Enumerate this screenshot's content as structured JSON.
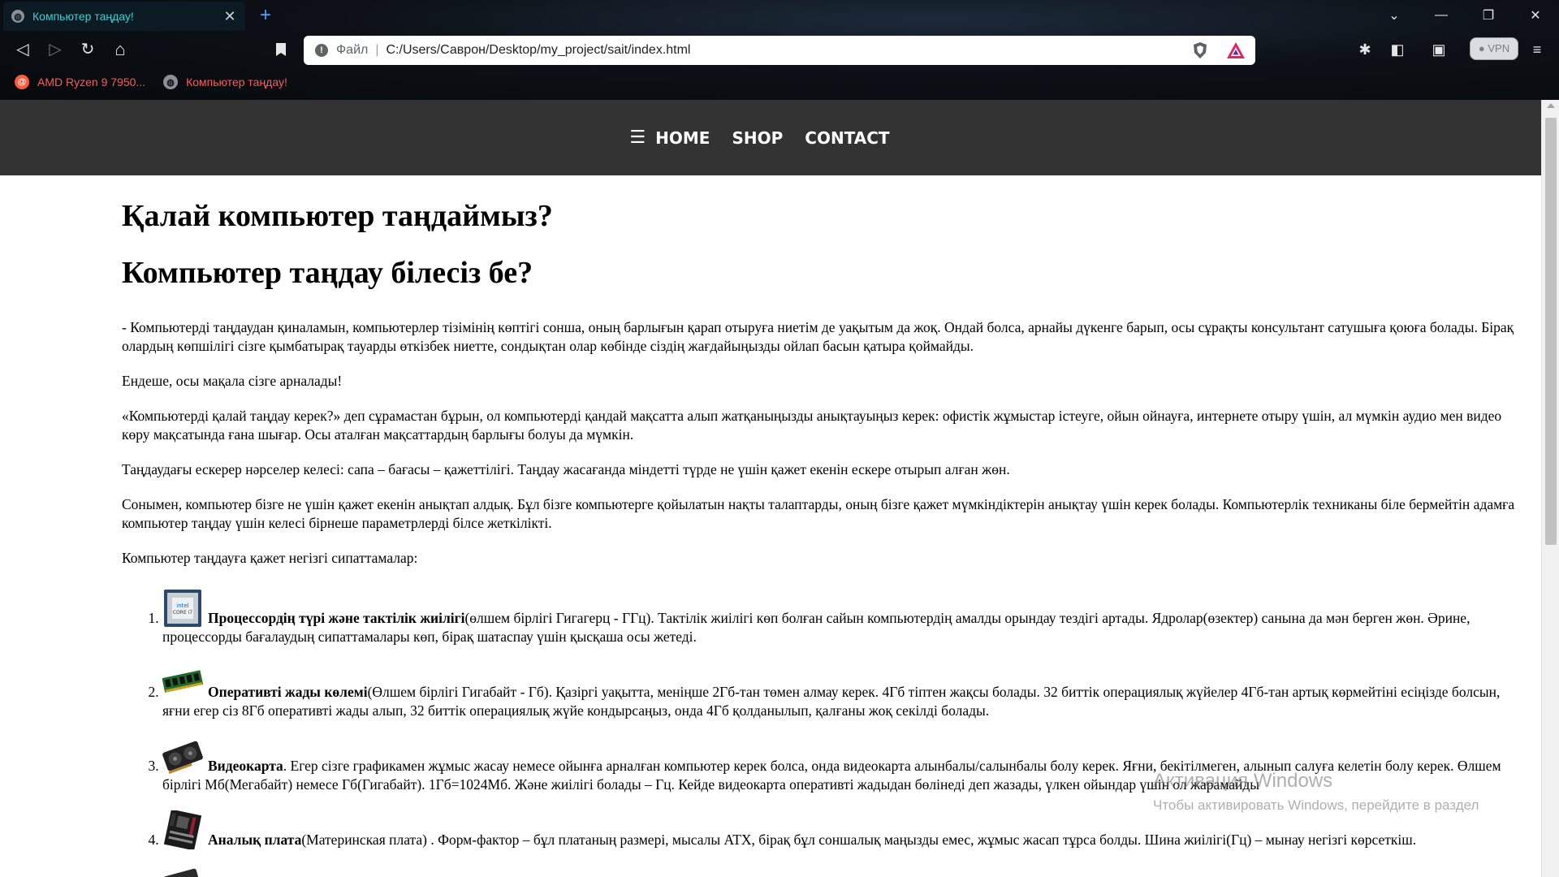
{
  "browser": {
    "tab": {
      "title": "Компьютер таңдау!",
      "close_glyph": "✕"
    },
    "new_tab_glyph": "+",
    "window_controls": {
      "dropdown": "⌄",
      "minimize": "—",
      "restore": "❐",
      "close": "✕"
    },
    "nav": {
      "back": "◁",
      "forward": "▷",
      "reload": "↻",
      "home": "⌂"
    },
    "address": {
      "scheme": "Файл",
      "url": "C:/Users/Саврон/Desktop/my_project/sait/index.html"
    },
    "toolbar_right": {
      "extensions": "✱",
      "sidebar": "◧",
      "wallet": "▣",
      "vpn": "VPN",
      "menu": "≡"
    },
    "bookmarks": [
      {
        "label": "AMD Ryzen 9 7950...",
        "icon": "amd-icon",
        "color": "#ff5a3c"
      },
      {
        "label": "Компьютер таңдау!",
        "icon": "globe-icon",
        "color": "#8a8f98"
      }
    ]
  },
  "site": {
    "nav": {
      "menu_icon": "☰",
      "items": [
        "HOME",
        "SHOP",
        "CONTACT"
      ]
    },
    "heading1": "Қалай компьютер таңдаймыз?",
    "heading2": "Компьютер таңдау білесіз бе?",
    "paragraphs": [
      "- Компьютерді таңдаудан қиналамын, компьютерлер тізімінің көптігі сонша, оның барлығын қарап отыруға ниетім де уақытым да жоқ. Ондай болса, арнайы дүкенге барып, осы сұрақты консультант сатушыға қоюға болады. Бірақ олардың көпшілігі сізге қымбатырақ тауарды өткізбек ниетте, сондықтан олар көбінде сіздің жағдайыңызды ойлап басын қатыра қоймайды.",
      "Ендеше, осы мақала сізге арналады!",
      "«Компьютерді қалай таңдау керек?» деп сұрамастан бұрын, ол компьютерді қандай мақсатта алып жатқаныңызды анықтауыңыз керек: офистік жұмыстар істеуге, ойын ойнауға, интернете отыру үшін, ал мүмкін аудио мен видео көру мақсатында ғана шығар. Осы аталған мақсаттардың барлығы болуы да мүмкін.",
      "Таңдаудағы ескерер нәрселер келесі: сапа – бағасы – қажеттілігі. Таңдау жасағанда міндетті түрде не үшін қажет екенін ескере отырып алған жөн.",
      "Сонымен, компьютер бізге не үшін қажет екенін анықтап алдық. Бұл бізге компьютерге қойылатын нақты талаптарды, оның бізге қажет мүмкіндіктерін анықтау үшін керек болады. Компьютерлік техниканы біле бермейтін адамға компьютер таңдау үшін келесі бірнеше параметрлерді білсе жеткілікті.",
      "Компьютер таңдауға қажет негізгі сипаттамалар:"
    ],
    "list": [
      {
        "icon": "cpu-icon",
        "bold": "Процессордің түрі және тактілік жиілігі",
        "text": "(өлшем бірлігі Гигагерц - ГГц). Тактілік жиілігі көп болған сайын компьютердің амалды орындау тездігі артады. Ядролар(өзектер) санына да мән берген жөн. Әрине, процессорды бағалаудың сипаттамалары көп, бірақ шатаспау үшін қысқаша осы жетеді."
      },
      {
        "icon": "ram-icon",
        "bold": "Оперативті жады көлемі",
        "text": "(Өлшем бірлігі Гигабайт - Гб). Қазіргі уақытта, меніңше 2Гб-тан төмен алмау керек. 4Гб тіптен жақсы болады. 32 биттік операциялық жүйелер 4Гб-тан артық көрмейтіні есіңізде болсын, яғни егер сіз 8Гб оперативті жады алып, 32 биттік операциялық жүйе кондырсаңыз, онда 4Гб қолданылып, қалғаны жоқ секілді болады."
      },
      {
        "icon": "gpu-icon",
        "bold": "Видеокарта",
        "text": ". Егер сізге графикамен жұмыс жасау немесе ойынға арналған компьютер керек болса, онда видеокарта алынбалы/салынбалы болу керек. Яғни, бекітілмеген, алынып салуға келетін болу керек. Өлшем бірлігі Мб(Мегабайт) немесе Гб(Гигабайт). 1Гб=1024Мб. Және жиілігі болады – Гц. Кейде видеокарта оперативті жадыдан бөлінеді деп жазады, үлкен ойындар үшін ол жарамайды"
      },
      {
        "icon": "motherboard-icon",
        "bold": "Аналық плата",
        "text": "(Материнская плата) . Форм-фактор – бұл платаның размері, мысалы ATX, бірақ бұл соншалық маңызды емес, жұмыс жасап тұрса болды. Шина жиілігі(Гц) – мынау негізгі көрсеткіш."
      },
      {
        "icon": "hdd-icon",
        "bold": "",
        "text": ""
      }
    ]
  },
  "watermark": {
    "line1": "Активация Windows",
    "line2": "Чтобы активировать Windows, перейдите в раздел"
  }
}
